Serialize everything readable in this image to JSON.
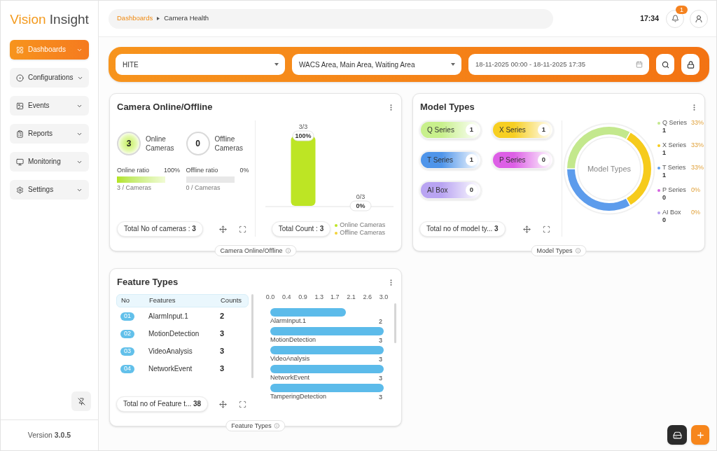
{
  "sidebar": {
    "logo": {
      "primary": "Vision",
      "secondary": "Insight"
    },
    "items": [
      {
        "label": "Dashboards",
        "selected": true
      },
      {
        "label": "Configurations",
        "selected": false
      },
      {
        "label": "Events",
        "selected": false
      },
      {
        "label": "Reports",
        "selected": false
      },
      {
        "label": "Monitoring",
        "selected": false
      },
      {
        "label": "Settings",
        "selected": false
      }
    ],
    "version": "Version **3.0.5**"
  },
  "header": {
    "breadcrumb": [
      "Dashboards",
      "Camera Health"
    ],
    "time": "17:34",
    "notification_count": "1"
  },
  "filters": [
    {
      "kind": "select",
      "value": "HITE"
    },
    {
      "kind": "select",
      "value": "WACS Area, Main Area, Waiting Area"
    },
    {
      "kind": "date",
      "value": "18-11-2025 00:00 - 18-11-2025 17:35"
    }
  ],
  "camera_card": {
    "title": "Camera Online/Offline",
    "stats": [
      {
        "kind": "online",
        "count": "3",
        "label": "Online Cameras",
        "ratio_label": "Online ratio",
        "ratio": "100%",
        "level": 1,
        "caption": "3 / Cameras"
      },
      {
        "kind": "offline",
        "count": "0",
        "label": "Offline Cameras",
        "ratio_label": "Offline ratio",
        "ratio": "0%",
        "level": 0,
        "caption": "0 / Cameras"
      }
    ],
    "total": "Total No of cameras : **3**",
    "bar_labels": [
      {
        "fraction": "3/3",
        "percent": "100%"
      },
      {
        "fraction": "0/3",
        "percent": "0%"
      }
    ],
    "total_count": "Total Count : **3**",
    "legend": [
      {
        "label": "Online Cameras",
        "color": "#bde524"
      },
      {
        "label": "Offline Cameras",
        "color": "#f2d23a"
      }
    ],
    "tag": "Camera Online/Offline"
  },
  "model_card": {
    "title": "Model Types",
    "types": [
      {
        "label": "Q Series",
        "count": "1",
        "color": "#c8f08c"
      },
      {
        "label": "X Series",
        "count": "1",
        "color": "#f7cf22"
      },
      {
        "label": "T Series",
        "count": "1",
        "color": "#4f95ea"
      },
      {
        "label": "P Series",
        "count": "0",
        "color": "#dd5fe6"
      },
      {
        "label": "AI Box",
        "count": "0",
        "color": "#b9a4f2"
      }
    ],
    "total": "Total no of model ty... **3**",
    "chart_data": {
      "type": "donut",
      "title": "Model Types",
      "categories": [
        "Q Series",
        "X Series",
        "T Series",
        "P Series",
        "AI Box"
      ],
      "values": [
        33,
        33,
        33,
        0,
        0
      ]
    },
    "legend": [
      {
        "count": "1",
        "percent": "33%",
        "color": "#c3e88d"
      },
      {
        "count": "1",
        "percent": "33%",
        "color": "#f6cb1c"
      },
      {
        "count": "1",
        "percent": "33%",
        "color": "#5d9cec"
      },
      {
        "count": "0",
        "percent": "0%",
        "color": "#d563e0"
      },
      {
        "count": "0",
        "percent": "0%",
        "color": "#b49cf0"
      }
    ],
    "tag": "Model Types"
  },
  "feature_card": {
    "title": "Feature Types",
    "columns": [
      "No",
      "Features",
      "Counts"
    ],
    "rows": [
      {
        "no": "01",
        "feature": "AlarmInput.1",
        "count": "2"
      },
      {
        "no": "02",
        "feature": "MotionDetection",
        "count": "3"
      },
      {
        "no": "03",
        "feature": "VideoAnalysis",
        "count": "3"
      },
      {
        "no": "04",
        "feature": "NetworkEvent",
        "count": "3"
      }
    ],
    "total": "Total no of Feature t... **38**",
    "chart_data": {
      "type": "bar",
      "orientation": "horizontal",
      "categories": [
        "AlarmInput.1",
        "MotionDetection",
        "VideoAnalysis",
        "NetworkEvent",
        "TamperingDetection"
      ],
      "values": [
        2,
        3,
        3,
        3,
        3
      ],
      "xlim": [
        0,
        3
      ],
      "xticks": [
        {
          "value": 0,
          "label": "0.0"
        },
        {
          "value": 0.43,
          "label": "0.4"
        },
        {
          "value": 0.86,
          "label": "0.9"
        },
        {
          "value": 1.29,
          "label": "1.3"
        },
        {
          "value": 1.71,
          "label": "1.7"
        },
        {
          "value": 2.14,
          "label": "2.1"
        },
        {
          "value": 2.57,
          "label": "2.6"
        },
        {
          "value": 3,
          "label": "3.0"
        }
      ],
      "data_labels": true
    },
    "tag": "Feature Types"
  }
}
